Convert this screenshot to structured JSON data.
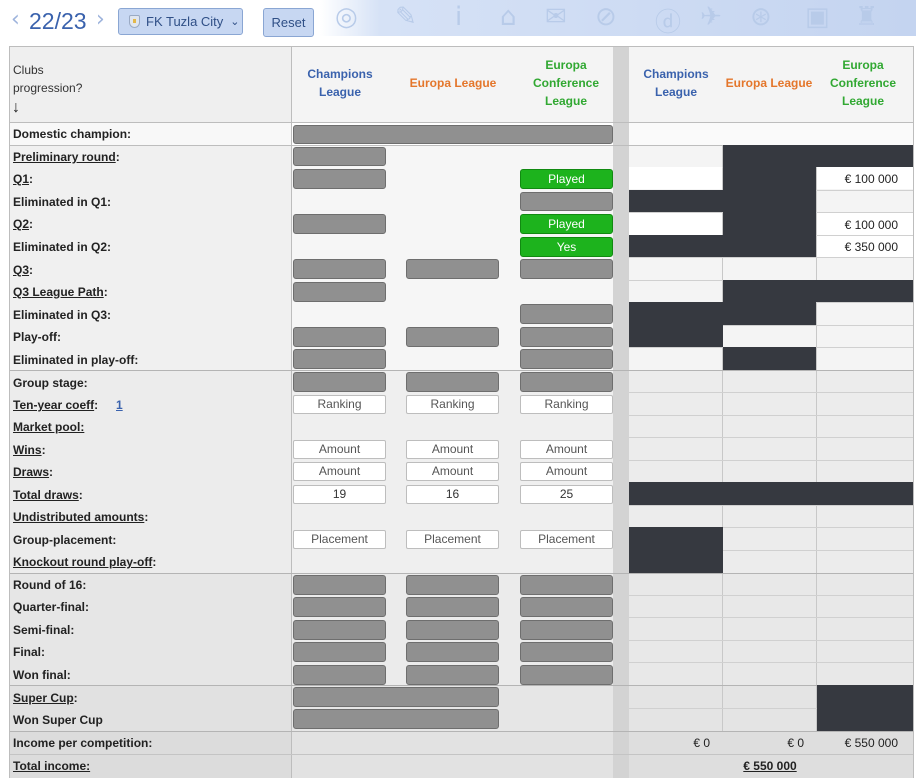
{
  "topbar": {
    "prev_arrow": "‹",
    "season": "22/23",
    "next_arrow": "›",
    "club_name": "FK Tuzla City",
    "club_chevron": "⌄",
    "reset_label": "Reset"
  },
  "header": {
    "clubs_progression": "Clubs",
    "clubs_progression_2": "progression?",
    "arrow": "↓",
    "champions_league_1": "Champions",
    "champions_league_2": "League",
    "europa_league": "Europa League",
    "conference_1": "Europa",
    "conference_2": "Conference",
    "conference_3": "League"
  },
  "rows": {
    "domestic_champion": "Domestic champion:",
    "preliminary_round": "Preliminary round",
    "q1": "Q1",
    "eliminated_q1": "Eliminated in Q1:",
    "q2": "Q2",
    "eliminated_q2": "Eliminated in Q2:",
    "q3": "Q3",
    "q3_league_path": "Q3 League Path",
    "eliminated_q3": "Eliminated in Q3:",
    "play_off": "Play-off:",
    "eliminated_play_off": "Eliminated in play-off:",
    "group_stage": "Group stage:",
    "ten_year_coeff": "Ten-year coeff",
    "ten_year_value": "1",
    "market_pool": "Market pool:",
    "wins": "Wins",
    "draws": "Draws",
    "total_draws": "Total draws",
    "undistributed": "Undistributed amounts",
    "group_placement": "Group-placement:",
    "knockout_playoff": "Knockout round play-off",
    "round_16": "Round of 16:",
    "quarter_final": "Quarter-final:",
    "semi_final": "Semi-final:",
    "final": "Final:",
    "won_final": "Won final:",
    "super_cup": "Super Cup",
    "won_super_cup": "Won Super Cup",
    "income_per_competition": "Income per competition:",
    "total_income": "Total income:",
    "colon": ":"
  },
  "inputs": {
    "played": "Played",
    "yes": "Yes",
    "ranking": "Ranking",
    "amount": "Amount",
    "placement": "Placement",
    "total_draws_cl": "19",
    "total_draws_el": "16",
    "total_draws_ecl": "25"
  },
  "income": {
    "q1_ecl": "€ 100 000",
    "q2_ecl": "€ 100 000",
    "elim_q2_ecl": "€ 350 000",
    "per_comp_cl": "€ 0",
    "per_comp_el": "€ 0",
    "per_comp_ecl": "€ 550 000",
    "total": "€ 550 000"
  },
  "colors": {
    "champions_league": "#3a62ad",
    "europa_league": "#e4762b",
    "conference_league": "#31a832",
    "selected_green": "#1db31d",
    "inactive_gray": "#909090",
    "blocked_dark": "#363940"
  }
}
